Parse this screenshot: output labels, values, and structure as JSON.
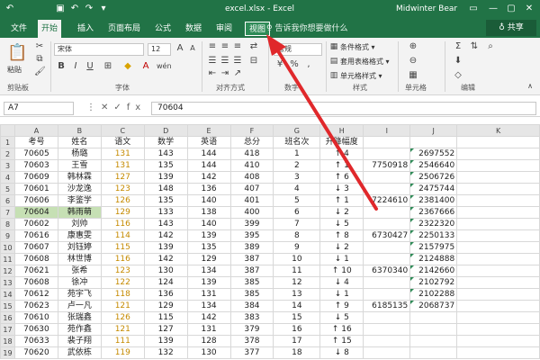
{
  "window": {
    "title": "excel.xlsx - Excel",
    "user": "Midwinter Bear",
    "quick_access": [
      "↶",
      "▣",
      "↶",
      "↷",
      "▾"
    ],
    "controls": [
      "▭",
      "—",
      "▢",
      "✕"
    ]
  },
  "tabs": [
    {
      "label": "文件"
    },
    {
      "label": "开始"
    },
    {
      "label": "插入"
    },
    {
      "label": "页面布局"
    },
    {
      "label": "公式"
    },
    {
      "label": "数据"
    },
    {
      "label": "审阅"
    },
    {
      "label": "视图"
    }
  ],
  "tell_me": "♀ 告诉我你想要做什么",
  "share": "♁ 共享",
  "ribbon": {
    "paste_label": "粘贴",
    "clipboard_label": "剪贴板",
    "font_name": "宋体",
    "font_size": "12",
    "font_label": "字体",
    "align_label": "对齐方式",
    "number_format": "常规",
    "number_label": "数字",
    "style_cond": "条件格式 ▾",
    "style_table": "套用表格格式 ▾",
    "style_cell": "单元格样式 ▾",
    "style_label": "样式",
    "cells_label": "单元格",
    "edit_label": "编辑"
  },
  "formula_bar": {
    "name_box": "A7",
    "icons": "⋮✕✓fx",
    "value": "70604"
  },
  "sheet": {
    "columns": [
      "A",
      "B",
      "C",
      "D",
      "E",
      "F",
      "G",
      "H",
      "I",
      "J",
      "K"
    ],
    "rows": [
      {
        "n": "1",
        "cells": [
          "考号",
          "姓名",
          "语文",
          "数学",
          "英语",
          "总分",
          "班名次",
          "升降幅度",
          "",
          "",
          ""
        ]
      },
      {
        "n": "2",
        "cells": [
          "70605",
          "杨璐",
          "131",
          "143",
          "144",
          "418",
          "1",
          "↑ 4",
          "",
          "2697552",
          ""
        ]
      },
      {
        "n": "3",
        "cells": [
          "70603",
          "王雪",
          "131",
          "135",
          "144",
          "410",
          "2",
          "↑ 1",
          "7750918",
          "2546640",
          ""
        ]
      },
      {
        "n": "4",
        "cells": [
          "70609",
          "韩林霖",
          "127",
          "139",
          "142",
          "408",
          "3",
          "↑ 6",
          "",
          "2506726",
          ""
        ]
      },
      {
        "n": "5",
        "cells": [
          "70601",
          "沙龙逸",
          "123",
          "148",
          "136",
          "407",
          "4",
          "↓ 3",
          "",
          "2475744",
          ""
        ]
      },
      {
        "n": "6",
        "cells": [
          "70606",
          "李鉴学",
          "126",
          "135",
          "140",
          "401",
          "5",
          "↑ 1",
          "7224610",
          "2381400",
          ""
        ]
      },
      {
        "n": "7",
        "cells": [
          "70604",
          "韩雨萌",
          "129",
          "133",
          "138",
          "400",
          "6",
          "↓ 2",
          "",
          "2367666",
          ""
        ]
      },
      {
        "n": "8",
        "cells": [
          "70602",
          "刘帅",
          "116",
          "143",
          "140",
          "399",
          "7",
          "↓ 5",
          "",
          "2322320",
          ""
        ]
      },
      {
        "n": "9",
        "cells": [
          "70616",
          "康惠雯",
          "114",
          "142",
          "139",
          "395",
          "8",
          "↑ 8",
          "6730427",
          "2250133",
          ""
        ]
      },
      {
        "n": "10",
        "cells": [
          "70607",
          "刘钰婷",
          "115",
          "139",
          "135",
          "389",
          "9",
          "↓ 2",
          "",
          "2157975",
          ""
        ]
      },
      {
        "n": "11",
        "cells": [
          "70608",
          "林世博",
          "116",
          "142",
          "129",
          "387",
          "10",
          "↓ 1",
          "",
          "2124888",
          ""
        ]
      },
      {
        "n": "12",
        "cells": [
          "70621",
          "张希",
          "123",
          "130",
          "134",
          "387",
          "11",
          "↑ 10",
          "6370340",
          "2142660",
          ""
        ]
      },
      {
        "n": "13",
        "cells": [
          "70608",
          "徐冲",
          "122",
          "124",
          "139",
          "385",
          "12",
          "↓ 4",
          "",
          "2102792",
          ""
        ]
      },
      {
        "n": "14",
        "cells": [
          "70612",
          "苑宇飞",
          "118",
          "136",
          "131",
          "385",
          "13",
          "↓ 1",
          "",
          "2102288",
          ""
        ]
      },
      {
        "n": "15",
        "cells": [
          "70623",
          "卢一凡",
          "121",
          "129",
          "134",
          "384",
          "14",
          "↑ 9",
          "6185135",
          "2068737",
          ""
        ]
      },
      {
        "n": "16",
        "cells": [
          "70610",
          "张瑞鑫",
          "126",
          "115",
          "142",
          "383",
          "15",
          "↓ 5",
          "",
          "",
          ""
        ]
      },
      {
        "n": "17",
        "cells": [
          "70630",
          "苑作鑫",
          "121",
          "127",
          "131",
          "379",
          "16",
          "↑ 16",
          "",
          "",
          ""
        ]
      },
      {
        "n": "18",
        "cells": [
          "70633",
          "裴子翔",
          "111",
          "139",
          "128",
          "378",
          "17",
          "↑ 15",
          "",
          "",
          ""
        ]
      },
      {
        "n": "19",
        "cells": [
          "70620",
          "武依栋",
          "119",
          "132",
          "130",
          "377",
          "18",
          "↓ 8",
          "",
          "",
          ""
        ]
      }
    ]
  },
  "colors": {
    "excel_green": "#217346",
    "arrow_red": "#e0282b",
    "score_orange": "#c58a00",
    "selected_row": "#c6e0b4"
  }
}
